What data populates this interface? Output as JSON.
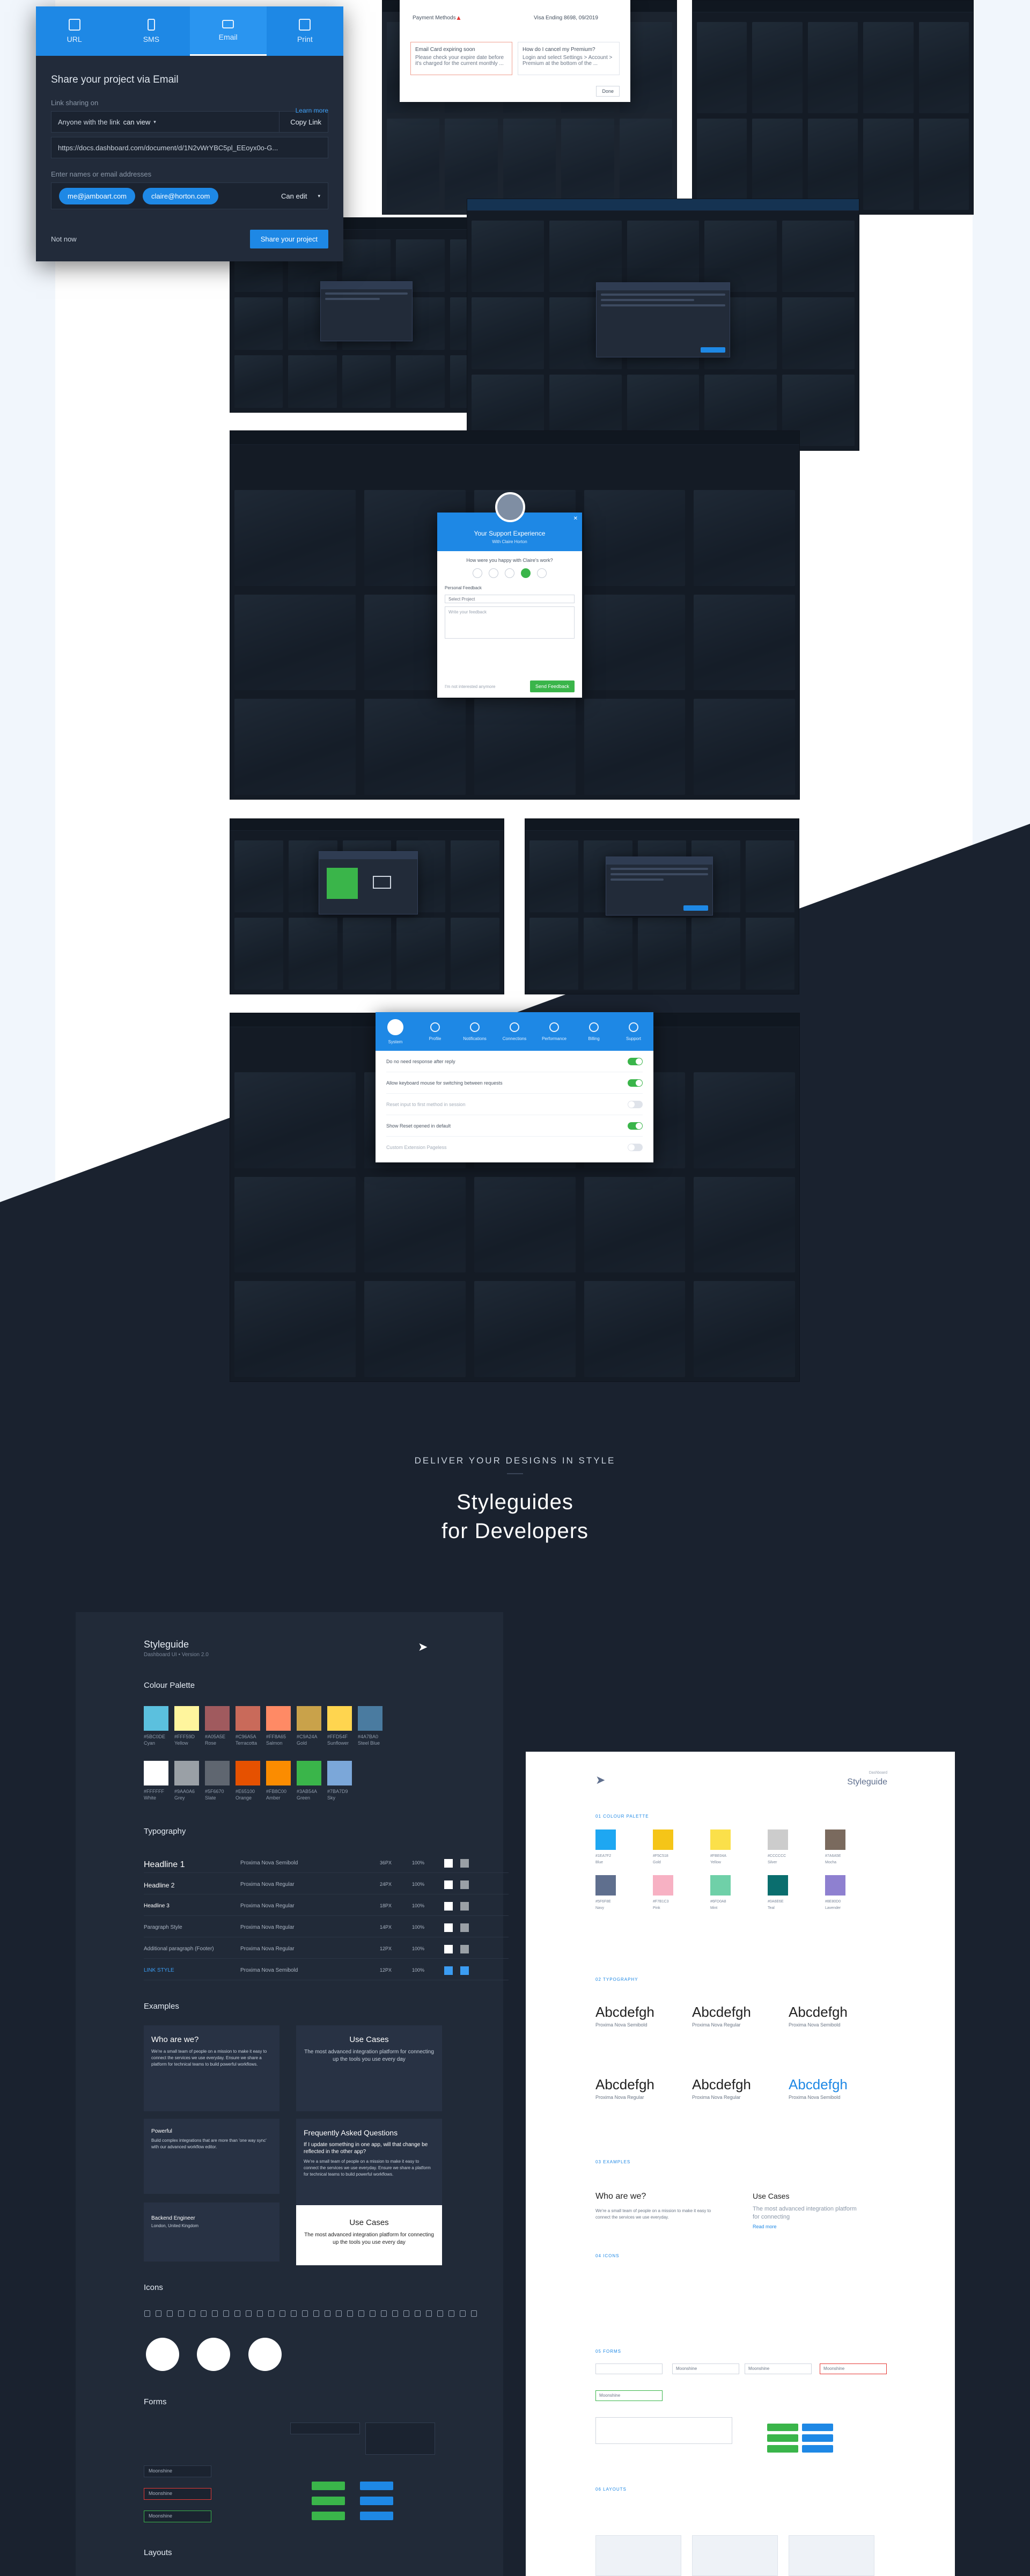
{
  "share_modal": {
    "tabs": [
      {
        "label": "URL",
        "icon": "link-icon",
        "active": false
      },
      {
        "label": "SMS",
        "icon": "phone-icon",
        "active": false
      },
      {
        "label": "Email",
        "icon": "mail-icon",
        "active": true
      },
      {
        "label": "Print",
        "icon": "printer-icon",
        "active": false
      }
    ],
    "title": "Share your project via Email",
    "link_sharing_label": "Link sharing on",
    "learn_more": "Learn more",
    "anyone_text": "Anyone with the link",
    "permission": "can view",
    "copy_link": "Copy Link",
    "url": "https://docs.dashboard.com/document/d/1N2vWrYBC5pl_EEoyx0o-G...",
    "emails_label": "Enter names or email addresses",
    "chips": [
      "me@jamboart.com",
      "claire@horton.com"
    ],
    "chip_permission": "Can edit",
    "not_now": "Not now",
    "primary": "Share your project",
    "accent": "#1e88e5"
  },
  "payment_dialog": {
    "method_label": "Payment Methods",
    "option": "Visa Ending 8698, 09/2019",
    "card_a_title": "Email Card expiring soon",
    "card_a_text": "Please check your expire date before it's charged for the current monthly ...",
    "card_b_title": "How do I cancel my Premium?",
    "card_b_text": "Login and select Settings > Account > Premium at the bottom of the ...",
    "button": "Done"
  },
  "survey_modal": {
    "title": "Your Support Experience",
    "subtitle": "With Claire Horton",
    "question": "How were you happy with Claire's work?",
    "rating_selected": 4,
    "section_label": "Personal Feedback",
    "select_placeholder": "Select Project",
    "textarea_placeholder": "Write your feedback",
    "skip": "I'm not interested anymore",
    "send": "Send Feedback"
  },
  "settings_modal": {
    "tabs": [
      "System",
      "Profile",
      "Notifications",
      "Connections",
      "Performance",
      "Billing",
      "Support"
    ],
    "options": [
      {
        "label": "Do no need response after reply",
        "on": true
      },
      {
        "label": "Allow keyboard mouse for switching between requests",
        "on": true
      },
      {
        "label": "Reset input to first method in session",
        "on": false
      },
      {
        "label": "Show Reset opened in default",
        "on": true
      },
      {
        "label": "Custom Extension Pageless",
        "on": false
      }
    ]
  },
  "section": {
    "eyebrow": "DELIVER YOUR DESIGNS IN STYLE",
    "title_line1": "Styleguides",
    "title_line2": "for Developers"
  },
  "dark_styleguide": {
    "title": "Styleguide",
    "subtitle": "Dashboard UI • Version 2.0",
    "palette_title": "Colour Palette",
    "palette": [
      {
        "hex": "#5BC0DE",
        "name": "Cyan"
      },
      {
        "hex": "#FFF59D",
        "name": "Yellow"
      },
      {
        "hex": "#A05A5E",
        "name": "Rose"
      },
      {
        "hex": "#C96A5A",
        "name": "Terracotta"
      },
      {
        "hex": "#FF8A65",
        "name": "Salmon"
      },
      {
        "hex": "#C9A24A",
        "name": "Gold"
      },
      {
        "hex": "#FFD54F",
        "name": "Sunflower"
      },
      {
        "hex": "#4A7BA0",
        "name": "Steel Blue"
      },
      {
        "hex": "#FFFFFF",
        "name": "White"
      },
      {
        "hex": "#9AA0A6",
        "name": "Grey"
      },
      {
        "hex": "#5F6670",
        "name": "Slate"
      },
      {
        "hex": "#E65100",
        "name": "Orange"
      },
      {
        "hex": "#FB8C00",
        "name": "Amber"
      },
      {
        "hex": "#3AB54A",
        "name": "Green"
      },
      {
        "hex": "#7BA7D9",
        "name": "Sky"
      }
    ],
    "typography_title": "Typography",
    "type_rows": [
      {
        "style": "Headline 1",
        "font": "Proxima Nova Semibold",
        "size": "36PX",
        "weight": "100%"
      },
      {
        "style": "Headline 2",
        "font": "Proxima Nova Regular",
        "size": "24PX",
        "weight": "100%"
      },
      {
        "style": "Headline 3",
        "font": "Proxima Nova Regular",
        "size": "18PX",
        "weight": "100%"
      },
      {
        "style": "Paragraph Style",
        "font": "Proxima Nova Regular",
        "size": "14PX",
        "weight": "100%"
      },
      {
        "style": "Additional paragraph (Footer)",
        "font": "Proxima Nova Regular",
        "size": "12PX",
        "weight": "100%"
      },
      {
        "style": "LINK STYLE",
        "font": "Proxima Nova Semibold",
        "size": "12PX",
        "weight": "100%"
      }
    ],
    "examples_title": "Examples",
    "ex_who_title": "Who are we?",
    "ex_who_text": "We're a small team of people on a mission to make it easy to connect the services we use everyday. Ensure we share a platform for technical teams to build powerful workflows.",
    "ex_use_title": "Use Cases",
    "ex_use_text": "The most advanced integration platform for connecting up the tools you use every day",
    "ex_faq_title": "Frequently Asked Questions",
    "ex_faq_q": "If I update something in one app, will that change be reflected in the other app?",
    "ex_faq_text": "We're a small team of people on a mission to make it easy to connect the services we use everyday. Ensure we share a platform for technical teams to build powerful workflows.",
    "ex_powerful": "Powerful",
    "ex_powerful_text": "Build complex integrations that are more than 'one way sync' with our advanced workflow editor.",
    "ex_engineer": "Backend Engineer",
    "ex_engineer_loc": "London, United Kingdom",
    "ex_use2_title": "Use Cases",
    "ex_use2_text": "The most advanced integration platform for connecting up the tools you use every day",
    "icons_title": "Icons",
    "forms_title": "Forms",
    "form_value": "Moonshine",
    "layouts_title": "Layouts"
  },
  "light_styleguide": {
    "brand": "Dashboard",
    "title": "Styleguide",
    "sec_palette": "01 COLOUR PALETTE",
    "palette": [
      {
        "hex": "#1EA7F2",
        "name": "Blue"
      },
      {
        "hex": "#F5C518",
        "name": "Gold"
      },
      {
        "hex": "#FBE04A",
        "name": "Yellow"
      },
      {
        "hex": "#CCCCCC",
        "name": "Silver"
      },
      {
        "hex": "#7A6A5E",
        "name": "Mocha"
      },
      {
        "hex": "#5F6F8E",
        "name": "Navy"
      },
      {
        "hex": "#F7B1C3",
        "name": "Pink"
      },
      {
        "hex": "#6FD0A8",
        "name": "Mint"
      },
      {
        "hex": "#0A6E6E",
        "name": "Teal"
      },
      {
        "hex": "#8E80D0",
        "name": "Lavender"
      }
    ],
    "sec_typo": "02 TYPOGRAPHY",
    "sample": "Abcdefgh",
    "fonts": [
      "Proxima Nova Semibold",
      "Proxima Nova Regular",
      "Proxima Nova Semibold",
      "Proxima Nova Regular",
      "Proxima Nova Regular",
      "Proxima Nova Semibold"
    ],
    "sec_examples": "03 EXAMPLES",
    "who": "Who are we?",
    "who_text": "We're a small team of people on a mission to make it easy to connect the services we use everyday.",
    "use": "Use Cases",
    "use_text": "The most advanced integration platform for connecting",
    "use_link": "Read more",
    "sec_icons": "04 ICONS",
    "sec_forms": "05 FORMS",
    "form_value": "Moonshine",
    "sec_layouts": "06 LAYOUTS"
  }
}
